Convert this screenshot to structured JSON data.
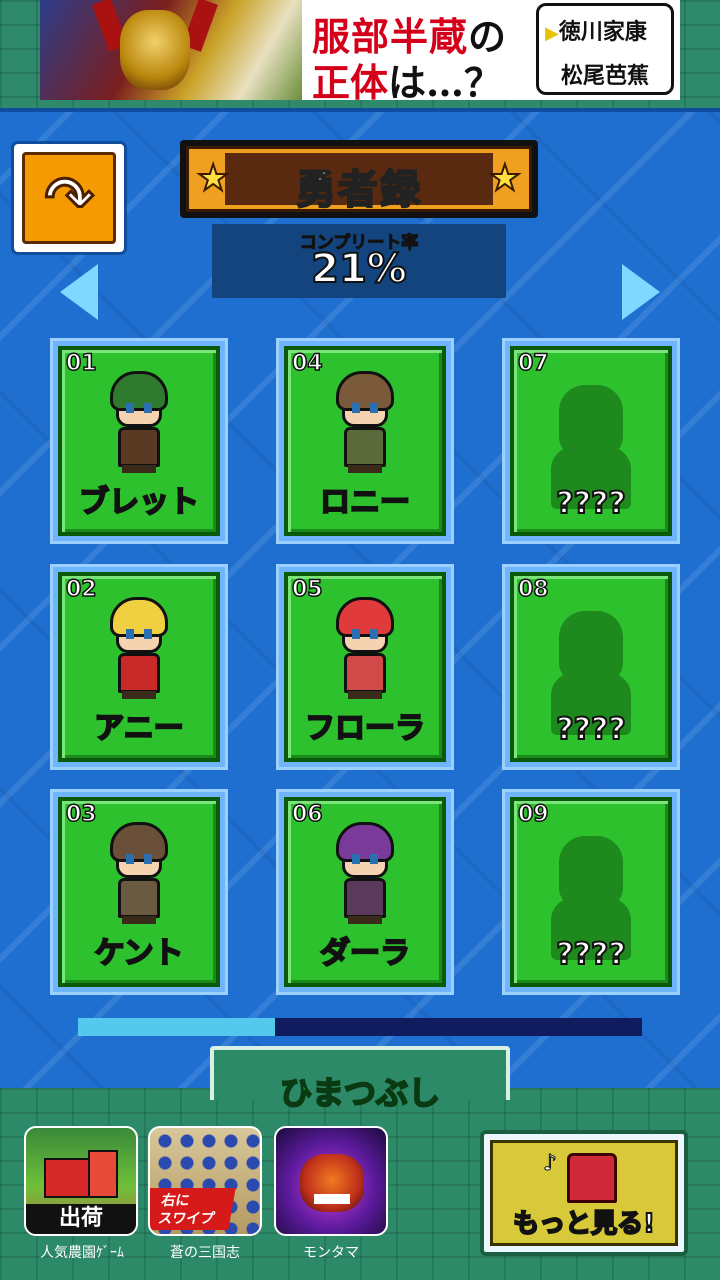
{
  "ad_banner": {
    "headline_main": "服部半蔵",
    "headline_particle": "の",
    "line2_red": "正体",
    "line2_rest": "は…？",
    "option1": "徳川家康",
    "option2": "松尾芭蕉"
  },
  "header": {
    "title": "勇者録",
    "complete_label": "コンプリート率",
    "complete_value": "21%"
  },
  "heroes": [
    {
      "number": "01",
      "name": "ブレット",
      "unlocked": true,
      "highlight": true,
      "hair": "#2f7a2f",
      "outfit": "#5a3a22"
    },
    {
      "number": "04",
      "name": "ロニー",
      "unlocked": true,
      "highlight": false,
      "hair": "#7a5a3a",
      "outfit": "#5a6a3a"
    },
    {
      "number": "07",
      "name": "????",
      "unlocked": false
    },
    {
      "number": "02",
      "name": "アニー",
      "unlocked": true,
      "highlight": false,
      "hair": "#f0d040",
      "outfit": "#c82a2a"
    },
    {
      "number": "05",
      "name": "フローラ",
      "unlocked": true,
      "highlight": false,
      "hair": "#e03a3a",
      "outfit": "#d04a4a"
    },
    {
      "number": "08",
      "name": "????",
      "unlocked": false
    },
    {
      "number": "03",
      "name": "ケント",
      "unlocked": true,
      "highlight": false,
      "hair": "#6a5038",
      "outfit": "#6a5a40"
    },
    {
      "number": "06",
      "name": "ダーラ",
      "unlocked": true,
      "highlight": false,
      "hair": "#7a3a9a",
      "outfit": "#5a3a5a"
    },
    {
      "number": "09",
      "name": "????",
      "unlocked": false
    }
  ],
  "pager": {
    "progress": 0.35
  },
  "bottom": {
    "section_label": "ひまつぶし",
    "apps": [
      {
        "label": "人気農園ｹﾞｰﾑ",
        "badge": "出荷"
      },
      {
        "label": "蒼の三国志",
        "badge": "右に\nスワイプ"
      },
      {
        "label": "モンタマ"
      }
    ],
    "more_button": "もっと見る!"
  },
  "colors": {
    "panel_blue": "#1e6fd0",
    "card_green": "#2ec12e",
    "accent_orange": "#f0a020",
    "name_gold": "#ffe23a"
  },
  "icons": {
    "back": "back-arrow-icon",
    "prev": "arrow-left-icon",
    "next": "arrow-right-icon",
    "star": "star-icon"
  }
}
